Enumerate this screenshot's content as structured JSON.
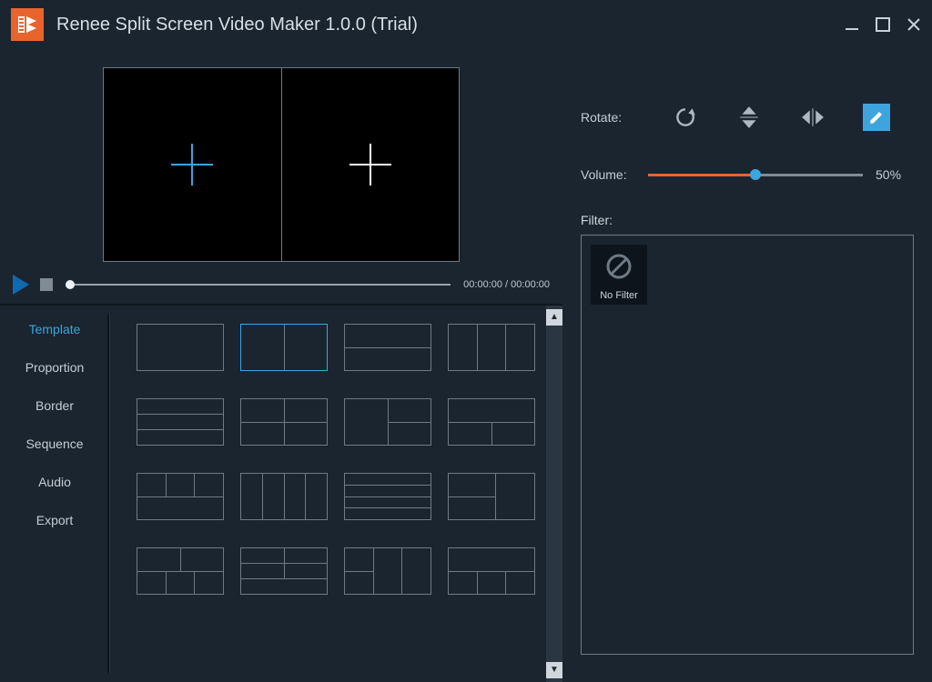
{
  "titlebar": {
    "title": "Renee Split Screen Video Maker 1.0.0 (Trial)"
  },
  "transport": {
    "time_current": "00:00:00",
    "time_total": "00:00:00"
  },
  "tabs": {
    "items": [
      {
        "label": "Template"
      },
      {
        "label": "Proportion"
      },
      {
        "label": "Border"
      },
      {
        "label": "Sequence"
      },
      {
        "label": "Audio"
      },
      {
        "label": "Export"
      }
    ],
    "active_index": 0
  },
  "rotate": {
    "label": "Rotate:"
  },
  "volume": {
    "label": "Volume:",
    "percent": 50,
    "display": "50%"
  },
  "filter": {
    "label": "Filter:",
    "items": [
      {
        "name": "No Filter"
      }
    ]
  }
}
